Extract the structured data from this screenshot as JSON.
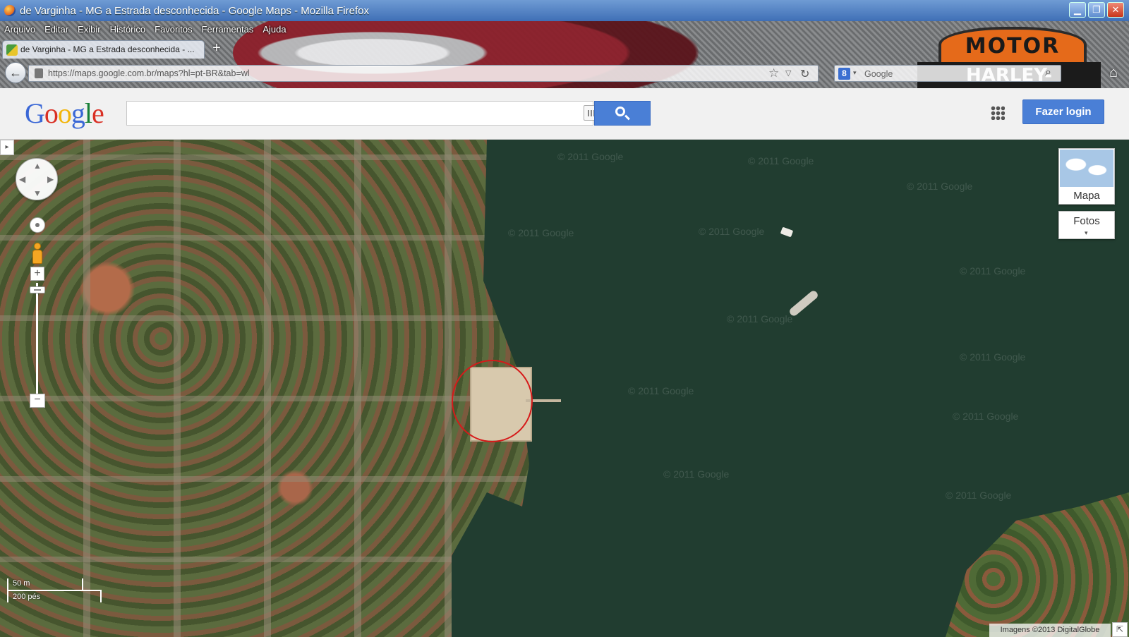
{
  "window": {
    "title": "de Varginha - MG a Estrada desconhecida - Google Maps - Mozilla Firefox",
    "minimize": "▁",
    "maximize": "❐",
    "close": "✕"
  },
  "skin": {
    "logo_top": "MOTOR",
    "logo_bottom": "HARLEY-DAVIDSON"
  },
  "menubar": [
    "Arquivo",
    "Editar",
    "Exibir",
    "Histórico",
    "Favoritos",
    "Ferramentas",
    "Ajuda"
  ],
  "tab": {
    "label": "de Varginha - MG a Estrada desconhecida - ...",
    "new_tab": "+"
  },
  "navbar": {
    "back": "←",
    "url": "https://maps.google.com.br/maps?hl=pt-BR&tab=wl",
    "star": "☆",
    "dropdown": "▽",
    "reload": "↻",
    "search_engine_icon": "8",
    "search_engine_drop": "▾",
    "search_placeholder": "Google",
    "search_icon": "⌕",
    "home": "⌂"
  },
  "google": {
    "logo": [
      "G",
      "o",
      "o",
      "g",
      "l",
      "e"
    ],
    "search_value": "",
    "login_label": "Fazer login"
  },
  "map": {
    "toggle": "▸",
    "pan_arrows": [
      "▲",
      "▼",
      "◀",
      "▶"
    ],
    "zoom_in": "+",
    "zoom_out": "−",
    "layer_map_label": "Mapa",
    "layer_photos_label": "Fotos",
    "photos_caret": "▾",
    "scale_metric": "50 m",
    "scale_imperial": "200 pés",
    "copyright": "Imagens ©2013 DigitalGlobe",
    "corner": "⇱",
    "watermarks": [
      "© 2011 Google",
      "© 2011 Google",
      "© 2011 Google",
      "© 2011 Google",
      "© 2011 Google",
      "© 2011 Google",
      "© 2011 Google",
      "© 2011 Google",
      "© 2011 Google",
      "© 2011 Google",
      "© 2011 Google",
      "© 2011 Google"
    ]
  },
  "colors": {
    "highlight": "#d61a1a",
    "water": "#213d30",
    "google_blue": "#4a7fd6"
  }
}
